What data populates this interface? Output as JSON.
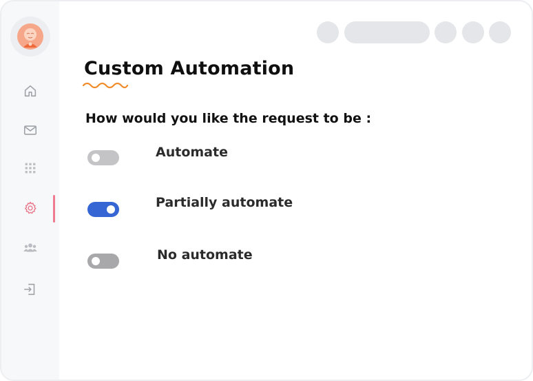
{
  "page": {
    "title": "Custom Automation",
    "question": "How would you like the request to be :"
  },
  "options": [
    {
      "label": "Automate",
      "enabled": false
    },
    {
      "label": "Partially automate",
      "enabled": true
    },
    {
      "label": "No automate",
      "enabled": false
    }
  ],
  "sidebar": {
    "items": [
      {
        "icon": "home-icon"
      },
      {
        "icon": "mail-icon"
      },
      {
        "icon": "grid-icon"
      },
      {
        "icon": "gear-icon",
        "active": true
      },
      {
        "icon": "users-icon"
      },
      {
        "icon": "logout-icon"
      }
    ]
  },
  "colors": {
    "accent": "#3665d4",
    "active_nav": "#f07a8f",
    "title_underline": "#f08c2a",
    "toggle_off": "#c4c4c6"
  }
}
